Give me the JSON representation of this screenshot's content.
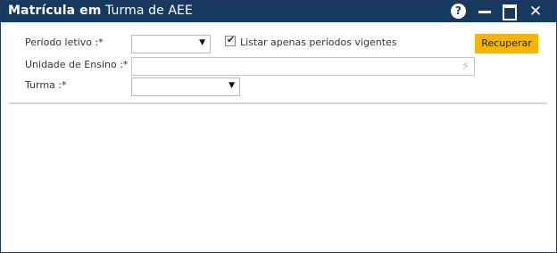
{
  "window": {
    "title_bold": "Matrícula em",
    "title_rest": " Turma de AEE",
    "help_label": "?",
    "close_label": "✕"
  },
  "form": {
    "periodo_label": "Período letivo :*",
    "periodo_value": "",
    "listar_label": "Listar apenas períodos vigentes",
    "listar_checked": true,
    "unidade_label": "Unidade de Ensino :*",
    "unidade_value": "",
    "turma_label": "Turma :*",
    "turma_value": "",
    "recuperar_label": "Recuperar"
  },
  "colors": {
    "titlebar": "#163a5f",
    "accent_button": "#f7b500"
  },
  "icons": {
    "dropdown": "chevron-down-icon",
    "checkbox": "check-icon",
    "unit_lookup": "lightning-icon"
  }
}
